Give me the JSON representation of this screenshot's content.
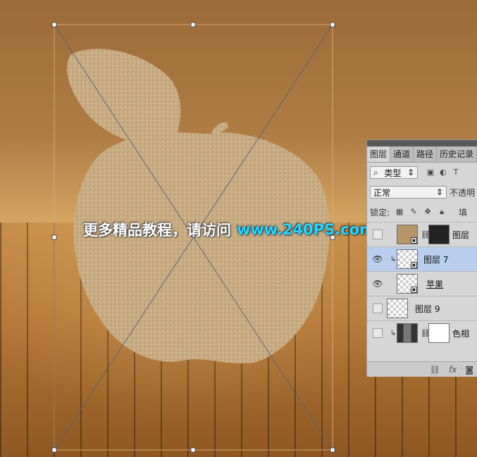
{
  "watermark": {
    "chinese": "更多精品教程，请访问",
    "url": "www.240PS.com"
  },
  "panel": {
    "tabs": [
      "图层",
      "通道",
      "路径",
      "历史记录"
    ],
    "active_tab": "图层",
    "filter": {
      "label": "类型",
      "icons": [
        "image-filter-icon",
        "adjustment-filter-icon",
        "type-filter-icon"
      ]
    },
    "blend_mode": "正常",
    "opacity_label": "不透明",
    "lock_label": "锁定:",
    "fill_label": "填",
    "layers": [
      {
        "name": "图层",
        "visible": false,
        "selected": false,
        "clipped": false,
        "thumb": "sand",
        "mask": true
      },
      {
        "name": "图层 7",
        "visible": true,
        "selected": true,
        "clipped": true,
        "thumb": "checker-sand",
        "mask": false
      },
      {
        "name": "苹果",
        "visible": true,
        "selected": false,
        "clipped": false,
        "thumb": "checker-apple",
        "mask": false
      },
      {
        "name": "图层 9",
        "visible": false,
        "selected": false,
        "clipped": false,
        "thumb": "checker",
        "mask": false
      },
      {
        "name": "色相",
        "visible": false,
        "selected": false,
        "clipped": true,
        "thumb": "film",
        "mask": true
      }
    ],
    "footer_icons": [
      "link-layers-icon",
      "fx-icon",
      "add-mask-icon"
    ],
    "footer_fx": "fx"
  },
  "colors": {
    "selected_layer": "#b9cfee",
    "watermark_url": "#2fd3ff"
  }
}
